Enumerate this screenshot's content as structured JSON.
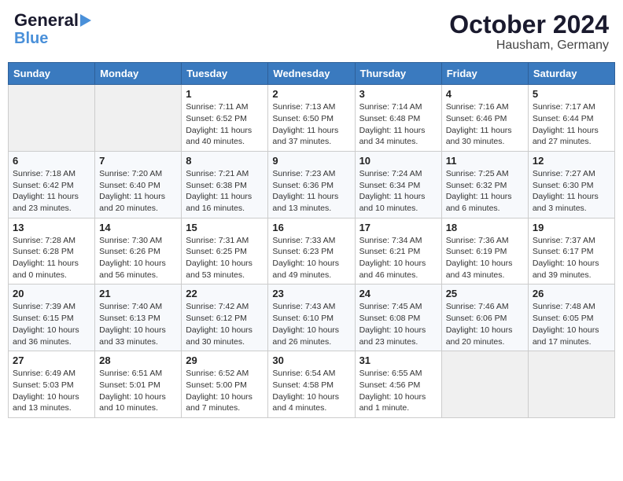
{
  "logo": {
    "line1": "General",
    "line2": "Blue"
  },
  "header": {
    "month_year": "October 2024",
    "location": "Hausham, Germany"
  },
  "weekdays": [
    "Sunday",
    "Monday",
    "Tuesday",
    "Wednesday",
    "Thursday",
    "Friday",
    "Saturday"
  ],
  "weeks": [
    [
      {
        "day": "",
        "info": ""
      },
      {
        "day": "",
        "info": ""
      },
      {
        "day": "1",
        "info": "Sunrise: 7:11 AM\nSunset: 6:52 PM\nDaylight: 11 hours and 40 minutes."
      },
      {
        "day": "2",
        "info": "Sunrise: 7:13 AM\nSunset: 6:50 PM\nDaylight: 11 hours and 37 minutes."
      },
      {
        "day": "3",
        "info": "Sunrise: 7:14 AM\nSunset: 6:48 PM\nDaylight: 11 hours and 34 minutes."
      },
      {
        "day": "4",
        "info": "Sunrise: 7:16 AM\nSunset: 6:46 PM\nDaylight: 11 hours and 30 minutes."
      },
      {
        "day": "5",
        "info": "Sunrise: 7:17 AM\nSunset: 6:44 PM\nDaylight: 11 hours and 27 minutes."
      }
    ],
    [
      {
        "day": "6",
        "info": "Sunrise: 7:18 AM\nSunset: 6:42 PM\nDaylight: 11 hours and 23 minutes."
      },
      {
        "day": "7",
        "info": "Sunrise: 7:20 AM\nSunset: 6:40 PM\nDaylight: 11 hours and 20 minutes."
      },
      {
        "day": "8",
        "info": "Sunrise: 7:21 AM\nSunset: 6:38 PM\nDaylight: 11 hours and 16 minutes."
      },
      {
        "day": "9",
        "info": "Sunrise: 7:23 AM\nSunset: 6:36 PM\nDaylight: 11 hours and 13 minutes."
      },
      {
        "day": "10",
        "info": "Sunrise: 7:24 AM\nSunset: 6:34 PM\nDaylight: 11 hours and 10 minutes."
      },
      {
        "day": "11",
        "info": "Sunrise: 7:25 AM\nSunset: 6:32 PM\nDaylight: 11 hours and 6 minutes."
      },
      {
        "day": "12",
        "info": "Sunrise: 7:27 AM\nSunset: 6:30 PM\nDaylight: 11 hours and 3 minutes."
      }
    ],
    [
      {
        "day": "13",
        "info": "Sunrise: 7:28 AM\nSunset: 6:28 PM\nDaylight: 11 hours and 0 minutes."
      },
      {
        "day": "14",
        "info": "Sunrise: 7:30 AM\nSunset: 6:26 PM\nDaylight: 10 hours and 56 minutes."
      },
      {
        "day": "15",
        "info": "Sunrise: 7:31 AM\nSunset: 6:25 PM\nDaylight: 10 hours and 53 minutes."
      },
      {
        "day": "16",
        "info": "Sunrise: 7:33 AM\nSunset: 6:23 PM\nDaylight: 10 hours and 49 minutes."
      },
      {
        "day": "17",
        "info": "Sunrise: 7:34 AM\nSunset: 6:21 PM\nDaylight: 10 hours and 46 minutes."
      },
      {
        "day": "18",
        "info": "Sunrise: 7:36 AM\nSunset: 6:19 PM\nDaylight: 10 hours and 43 minutes."
      },
      {
        "day": "19",
        "info": "Sunrise: 7:37 AM\nSunset: 6:17 PM\nDaylight: 10 hours and 39 minutes."
      }
    ],
    [
      {
        "day": "20",
        "info": "Sunrise: 7:39 AM\nSunset: 6:15 PM\nDaylight: 10 hours and 36 minutes."
      },
      {
        "day": "21",
        "info": "Sunrise: 7:40 AM\nSunset: 6:13 PM\nDaylight: 10 hours and 33 minutes."
      },
      {
        "day": "22",
        "info": "Sunrise: 7:42 AM\nSunset: 6:12 PM\nDaylight: 10 hours and 30 minutes."
      },
      {
        "day": "23",
        "info": "Sunrise: 7:43 AM\nSunset: 6:10 PM\nDaylight: 10 hours and 26 minutes."
      },
      {
        "day": "24",
        "info": "Sunrise: 7:45 AM\nSunset: 6:08 PM\nDaylight: 10 hours and 23 minutes."
      },
      {
        "day": "25",
        "info": "Sunrise: 7:46 AM\nSunset: 6:06 PM\nDaylight: 10 hours and 20 minutes."
      },
      {
        "day": "26",
        "info": "Sunrise: 7:48 AM\nSunset: 6:05 PM\nDaylight: 10 hours and 17 minutes."
      }
    ],
    [
      {
        "day": "27",
        "info": "Sunrise: 6:49 AM\nSunset: 5:03 PM\nDaylight: 10 hours and 13 minutes."
      },
      {
        "day": "28",
        "info": "Sunrise: 6:51 AM\nSunset: 5:01 PM\nDaylight: 10 hours and 10 minutes."
      },
      {
        "day": "29",
        "info": "Sunrise: 6:52 AM\nSunset: 5:00 PM\nDaylight: 10 hours and 7 minutes."
      },
      {
        "day": "30",
        "info": "Sunrise: 6:54 AM\nSunset: 4:58 PM\nDaylight: 10 hours and 4 minutes."
      },
      {
        "day": "31",
        "info": "Sunrise: 6:55 AM\nSunset: 4:56 PM\nDaylight: 10 hours and 1 minute."
      },
      {
        "day": "",
        "info": ""
      },
      {
        "day": "",
        "info": ""
      }
    ]
  ]
}
